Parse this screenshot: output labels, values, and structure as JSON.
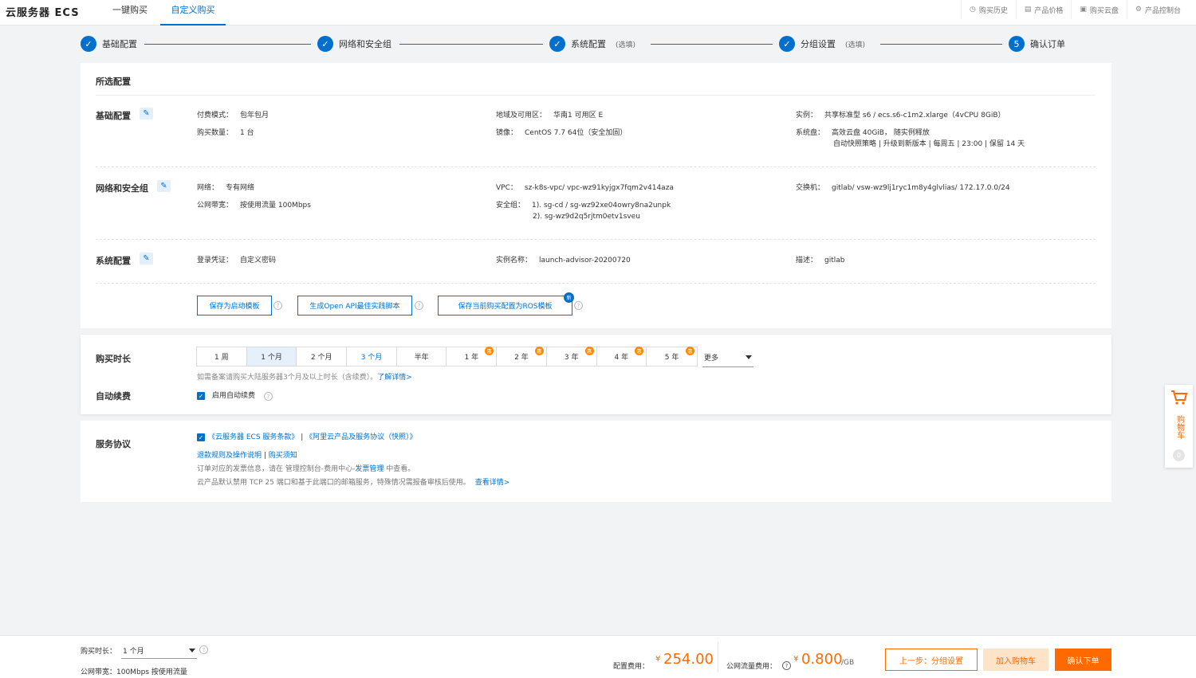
{
  "header": {
    "title": "云服务器 ECS",
    "tabs": [
      {
        "label": "一键购买"
      },
      {
        "label": "自定义购买"
      }
    ],
    "links": [
      {
        "label": "购买历史",
        "icon": "clock-icon"
      },
      {
        "label": "产品价格",
        "icon": "document-icon"
      },
      {
        "label": "购买云盘",
        "icon": "disk-icon"
      },
      {
        "label": "产品控制台",
        "icon": "gear-icon"
      }
    ]
  },
  "steps": [
    {
      "label": "基础配置",
      "optional": "",
      "marker": "✓"
    },
    {
      "label": "网络和安全组",
      "optional": "",
      "marker": "✓"
    },
    {
      "label": "系统配置",
      "optional": "(选填)",
      "marker": "✓"
    },
    {
      "label": "分组设置",
      "optional": "(选填)",
      "marker": "✓"
    },
    {
      "label": "确认订单",
      "optional": "",
      "marker": "5"
    }
  ],
  "summary": {
    "title": "所选配置",
    "basic": {
      "title": "基础配置",
      "pay_mode": {
        "k": "付费模式：",
        "v": "包年包月"
      },
      "qty": {
        "k": "购买数量：",
        "v": "1 台"
      },
      "region": {
        "k": "地域及可用区：",
        "v": "华南1 可用区 E"
      },
      "image": {
        "k": "镜像：",
        "v": "CentOS 7.7 64位（安全加固）"
      },
      "instance": {
        "k": "实例：",
        "v": "共享标准型 s6 / ecs.s6-c1m2.xlarge（4vCPU 8GiB）"
      },
      "disk": {
        "k": "系统盘：",
        "v": "高效云盘 40GiB， 随实例释放",
        "v2": "自动快照策略 | 升级到新版本 | 每周五 | 23:00 | 保留 14 天"
      }
    },
    "network": {
      "title": "网络和安全组",
      "net": {
        "k": "网络：",
        "v": "专有网络"
      },
      "bandwidth": {
        "k": "公网带宽：",
        "v": "按使用流量 100Mbps"
      },
      "vpc": {
        "k": "VPC：",
        "v": "sz-k8s-vpc/ vpc-wz91kyjgx7fqm2v414aza"
      },
      "sg": {
        "k": "安全组：",
        "v": "1). sg-cd / sg-wz92xe04owry8na2unpk",
        "v2": "2). sg-wz9d2q5rjtm0etv1sveu"
      },
      "vswitch": {
        "k": "交换机：",
        "v": "gitlab/ vsw-wz9lj1ryc1m8y4glvlias/ 172.17.0.0/24"
      }
    },
    "system": {
      "title": "系统配置",
      "cred": {
        "k": "登录凭证：",
        "v": "自定义密码"
      },
      "name": {
        "k": "实例名称：",
        "v": "launch-advisor-20200720"
      },
      "desc": {
        "k": "描述：",
        "v": "gitlab"
      }
    },
    "buttons": {
      "save_template": "保存为启动模板",
      "openapi": "生成Open API最佳实践脚本",
      "ros": "保存当前购买配置为ROS模板",
      "new_badge": "新"
    }
  },
  "duration": {
    "title": "购买时长",
    "options": [
      "1 周",
      "1 个月",
      "2 个月",
      "3 个月",
      "半年",
      "1 年",
      "2 年",
      "3 年",
      "4 年",
      "5 年"
    ],
    "selected": "1 个月",
    "discount_badge": "惠",
    "more": "更多",
    "note": "如需备案请购买大陆服务器3个月及以上时长（含续费）。",
    "note_link": "了解详情>",
    "auto_renew_title": "自动续费",
    "auto_renew_label": "启用自动续费",
    "auto_renew_checked": true
  },
  "agreement": {
    "title": "服务协议",
    "terms_link1": "《云服务器 ECS 服务条款》",
    "sep": " | ",
    "terms_link2": "《阿里云产品及服务协议（快照）》",
    "refund_link": "退款规则及操作说明",
    "purchase_notice": "购买须知",
    "invoice_prefix": "订单对应的发票信息，请在 管理控制台-费用中心-",
    "invoice_link": "发票管理",
    "invoice_suffix": " 中查看。",
    "port_note": "云产品默认禁用 TCP 25 端口和基于此端口的邮箱服务，特殊情况需报备审核后使用。",
    "port_link": "查看详情>"
  },
  "footer": {
    "duration_label": "购买时长：",
    "duration_value": "1 个月",
    "bandwidth_text": "公网带宽：100Mbps 按使用流量",
    "config_fee_label": "配置费用：",
    "currency": "¥",
    "config_fee": "254.00",
    "traffic_fee_label": "公网流量费用：",
    "traffic_fee": "0.800",
    "traffic_unit": "/GB",
    "prev_button": "上一步：分组设置",
    "cart_button": "加入购物车",
    "confirm_button": "确认下单"
  },
  "cart": {
    "label": "购物车",
    "count": "0"
  },
  "colors": {
    "primary": "#0070cc",
    "accent": "#ff6a00"
  }
}
